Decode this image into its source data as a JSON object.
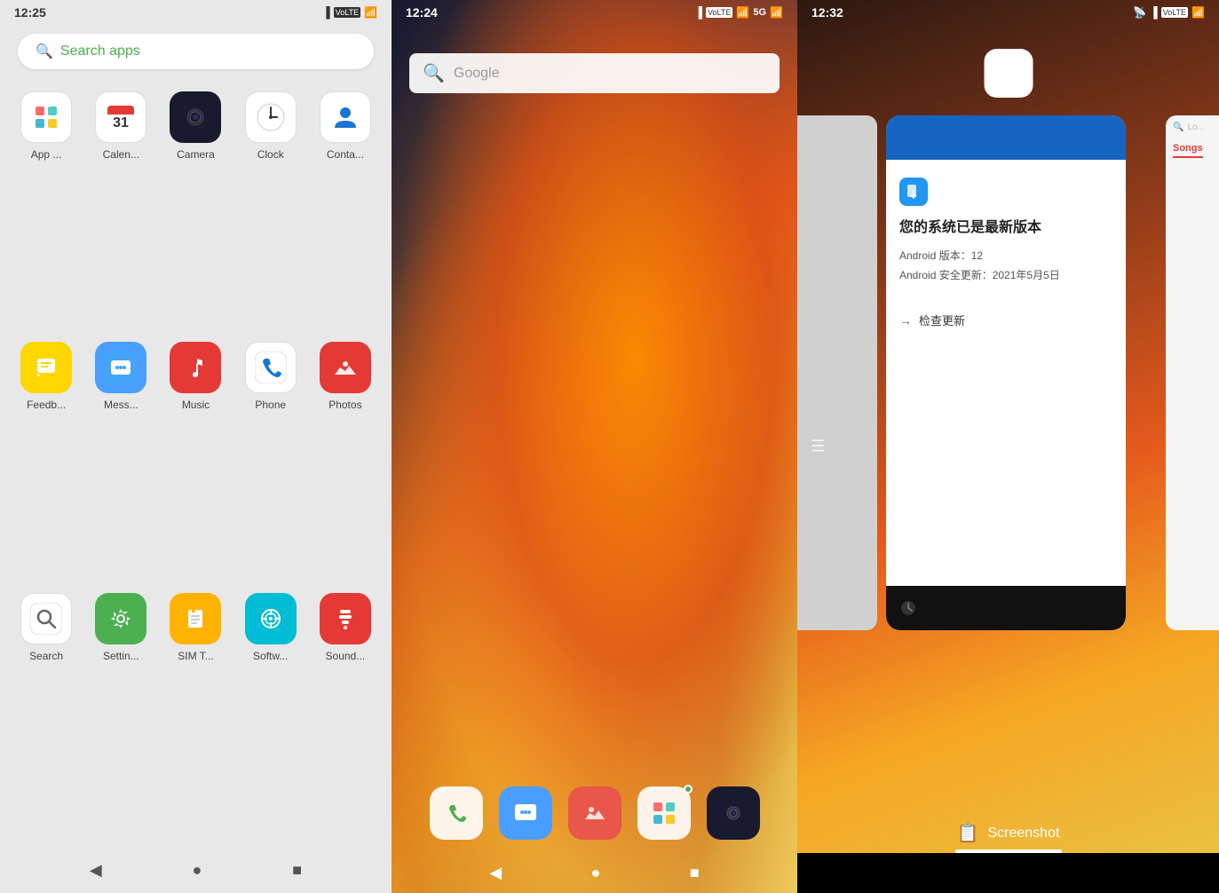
{
  "panel1": {
    "statusBar": {
      "time": "12:25",
      "icons": "▐▌ 📶"
    },
    "searchBar": {
      "placeholder": "Search apps"
    },
    "apps": [
      {
        "id": "appvault",
        "label": "App ...",
        "iconClass": "icon-appvault",
        "iconChar": "⊞"
      },
      {
        "id": "calendar",
        "label": "Calen...",
        "iconClass": "icon-calendar",
        "iconChar": "31"
      },
      {
        "id": "camera",
        "label": "Camera",
        "iconClass": "icon-camera",
        "iconChar": "●"
      },
      {
        "id": "clock",
        "label": "Clock",
        "iconClass": "icon-clock",
        "iconChar": "🕐"
      },
      {
        "id": "contacts",
        "label": "Conta...",
        "iconClass": "icon-contacts",
        "iconChar": "👤"
      },
      {
        "id": "feedback",
        "label": "Feedb...",
        "iconClass": "icon-feedback",
        "iconChar": "💬"
      },
      {
        "id": "messages",
        "label": "Mess...",
        "iconClass": "icon-messages",
        "iconChar": "💬"
      },
      {
        "id": "music",
        "label": "Music",
        "iconClass": "icon-music",
        "iconChar": "♪"
      },
      {
        "id": "phone",
        "label": "Phone",
        "iconClass": "icon-phone",
        "iconChar": "📞"
      },
      {
        "id": "photos",
        "label": "Photos",
        "iconClass": "icon-photos",
        "iconChar": "🌸"
      },
      {
        "id": "search",
        "label": "Search",
        "iconClass": "icon-search",
        "iconChar": "🔍"
      },
      {
        "id": "settings",
        "label": "Settin...",
        "iconClass": "icon-settings",
        "iconChar": "⚙"
      },
      {
        "id": "simtoolkit",
        "label": "SIM T...",
        "iconClass": "icon-simtoolkit",
        "iconChar": "💳"
      },
      {
        "id": "software",
        "label": "Softw...",
        "iconClass": "icon-software",
        "iconChar": "↑"
      },
      {
        "id": "soundrecorder",
        "label": "Sound...",
        "iconClass": "icon-soundrecorder",
        "iconChar": "🎙"
      }
    ],
    "navBar": {
      "back": "◀",
      "home": "●",
      "recent": "■"
    }
  },
  "panel2": {
    "statusBar": {
      "time": "12:24",
      "rightIcons": "* 5G 📶"
    },
    "googleSearch": {
      "placeholder": "Google"
    },
    "dock": [
      {
        "id": "phone",
        "iconChar": "📞",
        "colorClass": "dock-icon-phone"
      },
      {
        "id": "messages",
        "iconChar": "💬",
        "colorClass": "dock-icon-msg"
      },
      {
        "id": "photos",
        "iconChar": "🌸",
        "colorClass": "dock-icon-photos"
      },
      {
        "id": "appvault",
        "iconChar": "⊞",
        "colorClass": "dock-icon-appvault",
        "badge": true
      },
      {
        "id": "camera",
        "iconChar": "●",
        "colorClass": "dock-icon-camera"
      }
    ],
    "navBar": {
      "back": "◀",
      "home": "●",
      "recent": "■"
    }
  },
  "panel3": {
    "statusBar": {
      "time": "12:32",
      "rightIcons": "📶📶📶"
    },
    "recentApps": {
      "updateCard": {
        "title": "您的系统已是最新版本",
        "androidVersion": "Android 版本：12",
        "securityUpdate": "Android 安全更新：2021年5月5日",
        "checkUpdateLabel": "检查更新"
      },
      "rightCard": {
        "songsTab": "Songs"
      }
    },
    "screenshot": {
      "label": "Screenshot",
      "iconChar": "📋"
    }
  }
}
